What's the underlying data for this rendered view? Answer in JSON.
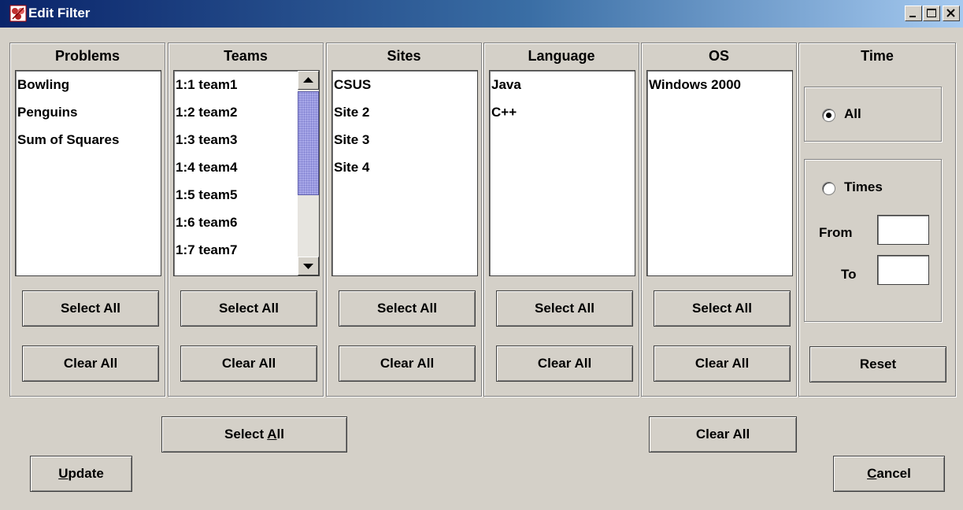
{
  "window": {
    "title": "Edit Filter",
    "minimize_label": "_",
    "maximize_label": "□",
    "close_label": "×"
  },
  "columns": [
    {
      "title": "Problems",
      "items": [
        "Bowling",
        "Penguins",
        "Sum of Squares"
      ],
      "select_all": "Select All",
      "clear_all": "Clear All"
    },
    {
      "title": "Teams",
      "items": [
        "1:1 team1",
        "1:2 team2",
        "1:3 team3",
        "1:4 team4",
        "1:5 team5",
        "1:6 team6",
        "1:7 team7"
      ],
      "select_all": "Select All",
      "clear_all": "Clear All"
    },
    {
      "title": "Sites",
      "items": [
        "CSUS",
        "Site 2",
        "Site 3",
        "Site 4"
      ],
      "select_all": "Select All",
      "clear_all": "Clear All"
    },
    {
      "title": "Language",
      "items": [
        "Java",
        "C++"
      ],
      "select_all": "Select All",
      "clear_all": "Clear All"
    },
    {
      "title": "OS",
      "items": [
        "Windows 2000"
      ],
      "select_all": "Select All",
      "clear_all": "Clear All"
    }
  ],
  "time": {
    "title": "Time",
    "all_label": "All",
    "all_selected": true,
    "times_label": "Times",
    "times_selected": false,
    "from_label": "From",
    "from_value": "",
    "to_label": "To",
    "to_value": "",
    "reset_label": "Reset"
  },
  "bottom": {
    "select_all_prefix": "Select ",
    "select_all_mnemonic": "A",
    "select_all_suffix": "ll",
    "clear_all_label": "Clear All",
    "update_mnemonic": "U",
    "update_suffix": "pdate",
    "cancel_mnemonic": "C",
    "cancel_suffix": "ancel"
  },
  "icons": {
    "app": "edit-filter-app-icon",
    "scroll_up": "triangle-up-icon",
    "scroll_down": "triangle-down-icon"
  }
}
